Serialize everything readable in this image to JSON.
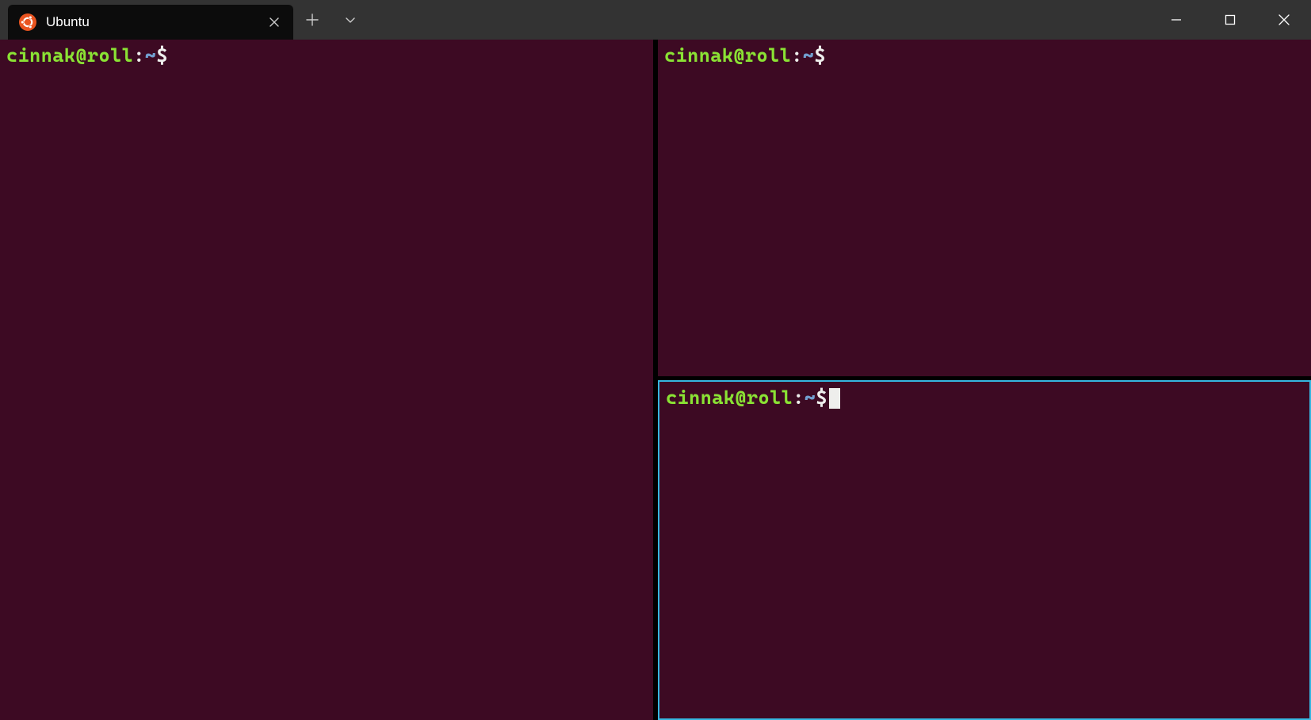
{
  "titlebar": {
    "tab": {
      "label": "Ubuntu",
      "icon": "ubuntu-logo-icon"
    },
    "buttons": {
      "new_tab": "plus-icon",
      "dropdown": "chevron-down-icon",
      "minimize": "minimize-icon",
      "maximize": "maximize-icon",
      "close": "close-icon"
    }
  },
  "panes": {
    "left": {
      "prompt": {
        "user_host": "cinnak@roll",
        "colon": ":",
        "cwd": "~",
        "symbol": "$"
      },
      "active": false
    },
    "right_top": {
      "prompt": {
        "user_host": "cinnak@roll",
        "colon": ":",
        "cwd": "~",
        "symbol": "$"
      },
      "active": false
    },
    "right_bottom": {
      "prompt": {
        "user_host": "cinnak@roll",
        "colon": ":",
        "cwd": "~",
        "symbol": "$"
      },
      "active": true
    }
  },
  "colors": {
    "terminal_bg": "#3d0a23",
    "titlebar_bg": "#333333",
    "tab_bg": "#0c0c0c",
    "prompt_user": "#8ae234",
    "prompt_cwd": "#729fcf",
    "prompt_text": "#eeeeec",
    "active_pane_border": "#36b6e0",
    "splitter": "#000000"
  }
}
